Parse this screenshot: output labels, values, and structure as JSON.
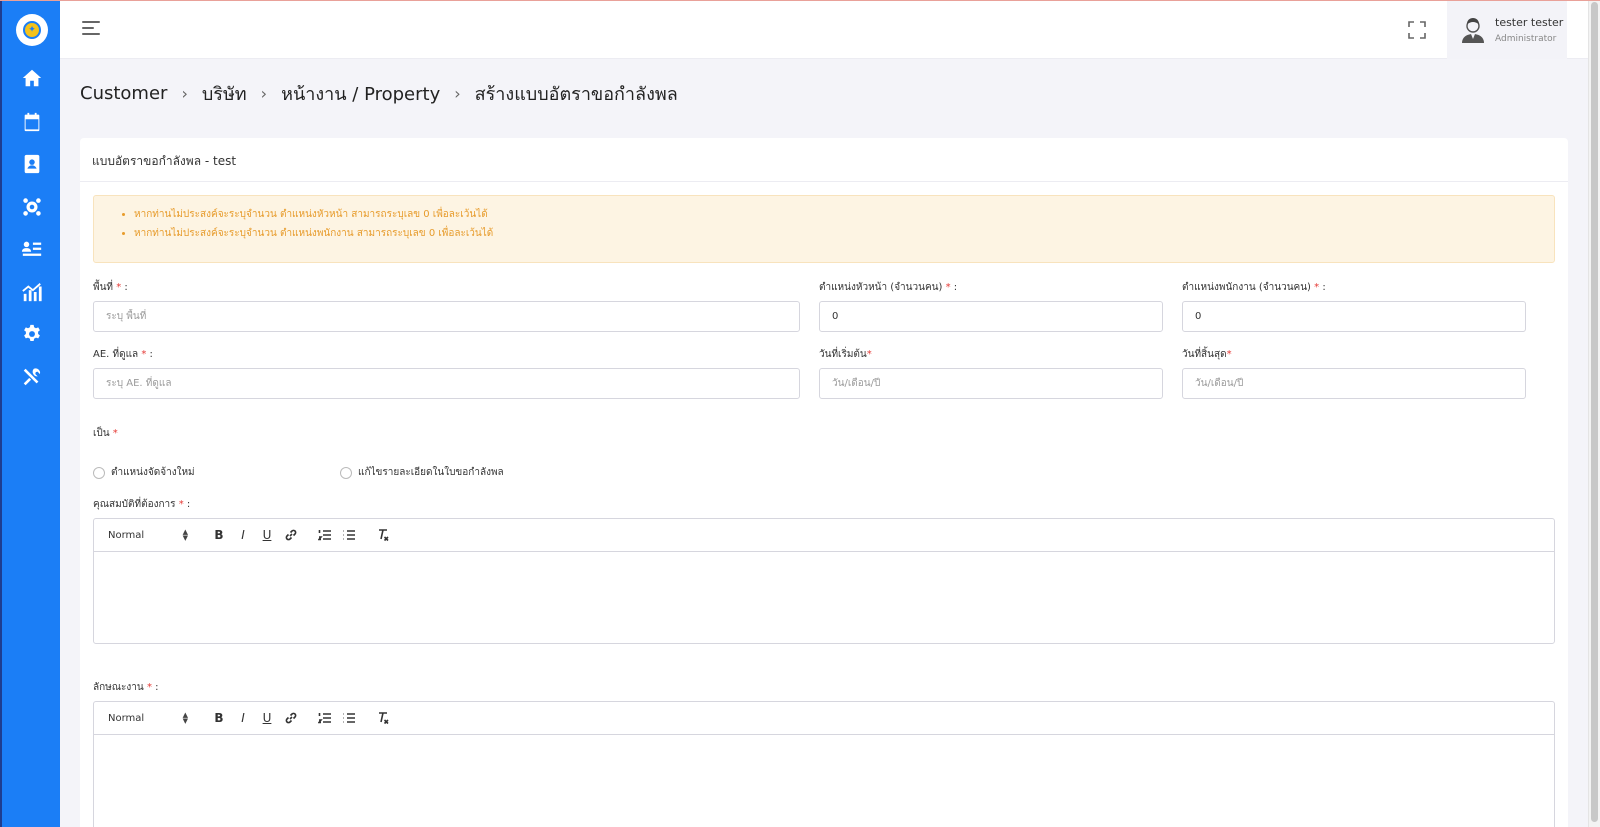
{
  "colors": {
    "sidebar": "#1b7ef6",
    "alert_bg": "#fdf4e3",
    "alert_text": "#e79b2b",
    "required": "#e53935"
  },
  "sidebar": {
    "logo_icon": "brand-logo-icon",
    "items": [
      {
        "icon": "home-icon"
      },
      {
        "icon": "calendar-dollar-icon"
      },
      {
        "icon": "contact-book-icon"
      },
      {
        "icon": "users-gear-icon"
      },
      {
        "icon": "user-list-icon"
      },
      {
        "icon": "chart-icon"
      },
      {
        "icon": "gear-icon"
      },
      {
        "icon": "tools-icon"
      }
    ]
  },
  "header": {
    "user_name": "tester tester",
    "user_role": "Administrator"
  },
  "breadcrumb": [
    "Customer",
    "บริษัท",
    "หน้างาน / Property",
    "สร้างแบบอัตราขอกำลังพล"
  ],
  "card": {
    "title": "แบบอัตราขอกำลังพล - test",
    "alerts": [
      "หากท่านไม่ประสงค์จะระบุจำนวน ตำแหน่งหัวหน้า สามารถระบุเลข 0 เพื่อละเว้นได้",
      "หากท่านไม่ประสงค์จะระบุจำนวน ตำแหน่งพนักงาน สามารถระบุเลข 0 เพื่อละเว้นได้"
    ],
    "area_label": "พื้นที่",
    "area_suffix": " :",
    "area_placeholder": "ระบุ พื้นที่",
    "head_label": "ตำแหน่งหัวหน้า (จำนวนคน)",
    "head_suffix": " :",
    "head_value": "0",
    "staff_label": "ตำแหน่งพนักงาน (จำนวนคน)",
    "staff_suffix": " :",
    "staff_value": "0",
    "ae_label": "AE. ที่ดูแล",
    "ae_suffix": " :",
    "ae_placeholder": "ระบุ AE. ที่ดูแล",
    "start_label": "วันที่เริ่มต้น",
    "start_placeholder": "วัน/เดือน/ปี",
    "end_label": "วันที่สิ้นสุด",
    "end_placeholder": "วัน/เดือน/ปี",
    "type_label": "เป็น",
    "radio_new": "ตำแหน่งจัดจ้างใหม่",
    "radio_edit": "แก้ไขรายละเอียดในใบขอกำลังพล",
    "qualification_label": "คุณสมบัติที่ต้องการ",
    "qualification_suffix": " :",
    "job_label": "ลักษณะงาน",
    "job_suffix": " :",
    "required_mark": "*",
    "editor_format": "Normal"
  }
}
